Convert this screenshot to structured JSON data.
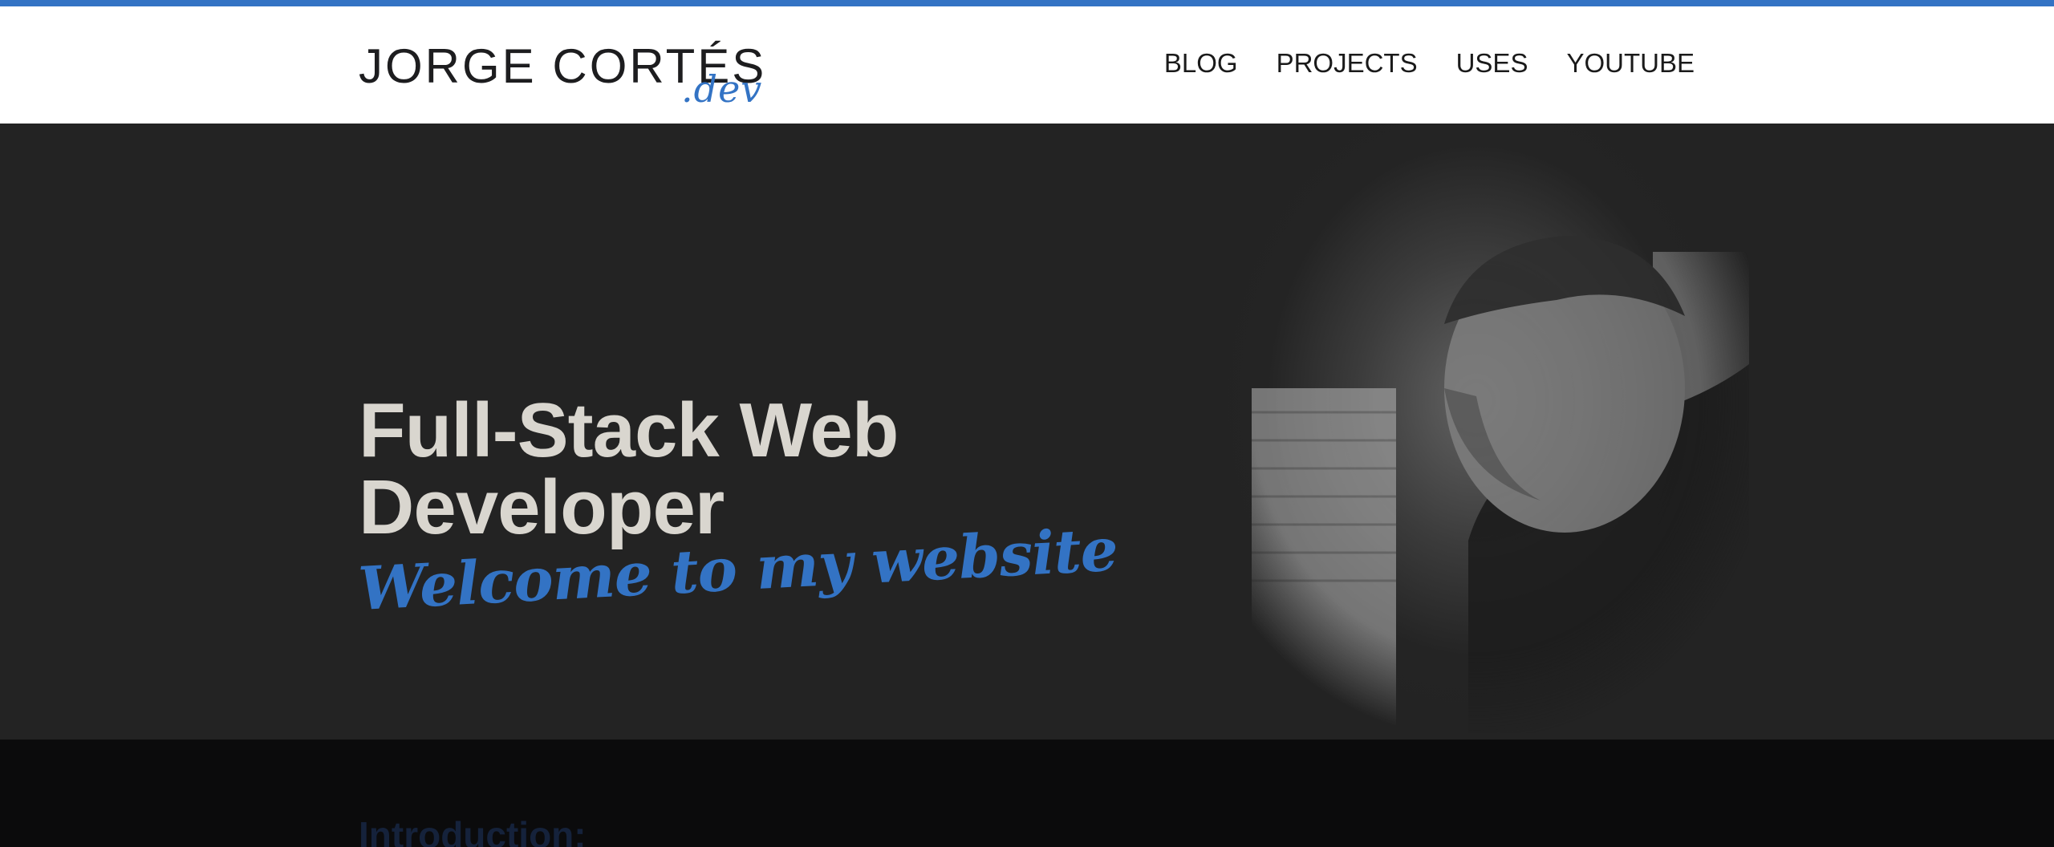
{
  "header": {
    "brand_name": "JORGE CORTÉS",
    "brand_tld": ".dev",
    "nav": [
      "BLOG",
      "PROJECTS",
      "USES",
      "YOUTUBE"
    ]
  },
  "hero": {
    "title": "Full-Stack Web Developer",
    "script": "Welcome to my website"
  },
  "intro": {
    "heading": "Introduction:"
  },
  "colors": {
    "accent": "#3373c4",
    "hero_bg": "#232323",
    "hero_title": "#d9d6cf",
    "page_bg": "#0b0b0c"
  },
  "icons": [
    "profile-photo"
  ]
}
